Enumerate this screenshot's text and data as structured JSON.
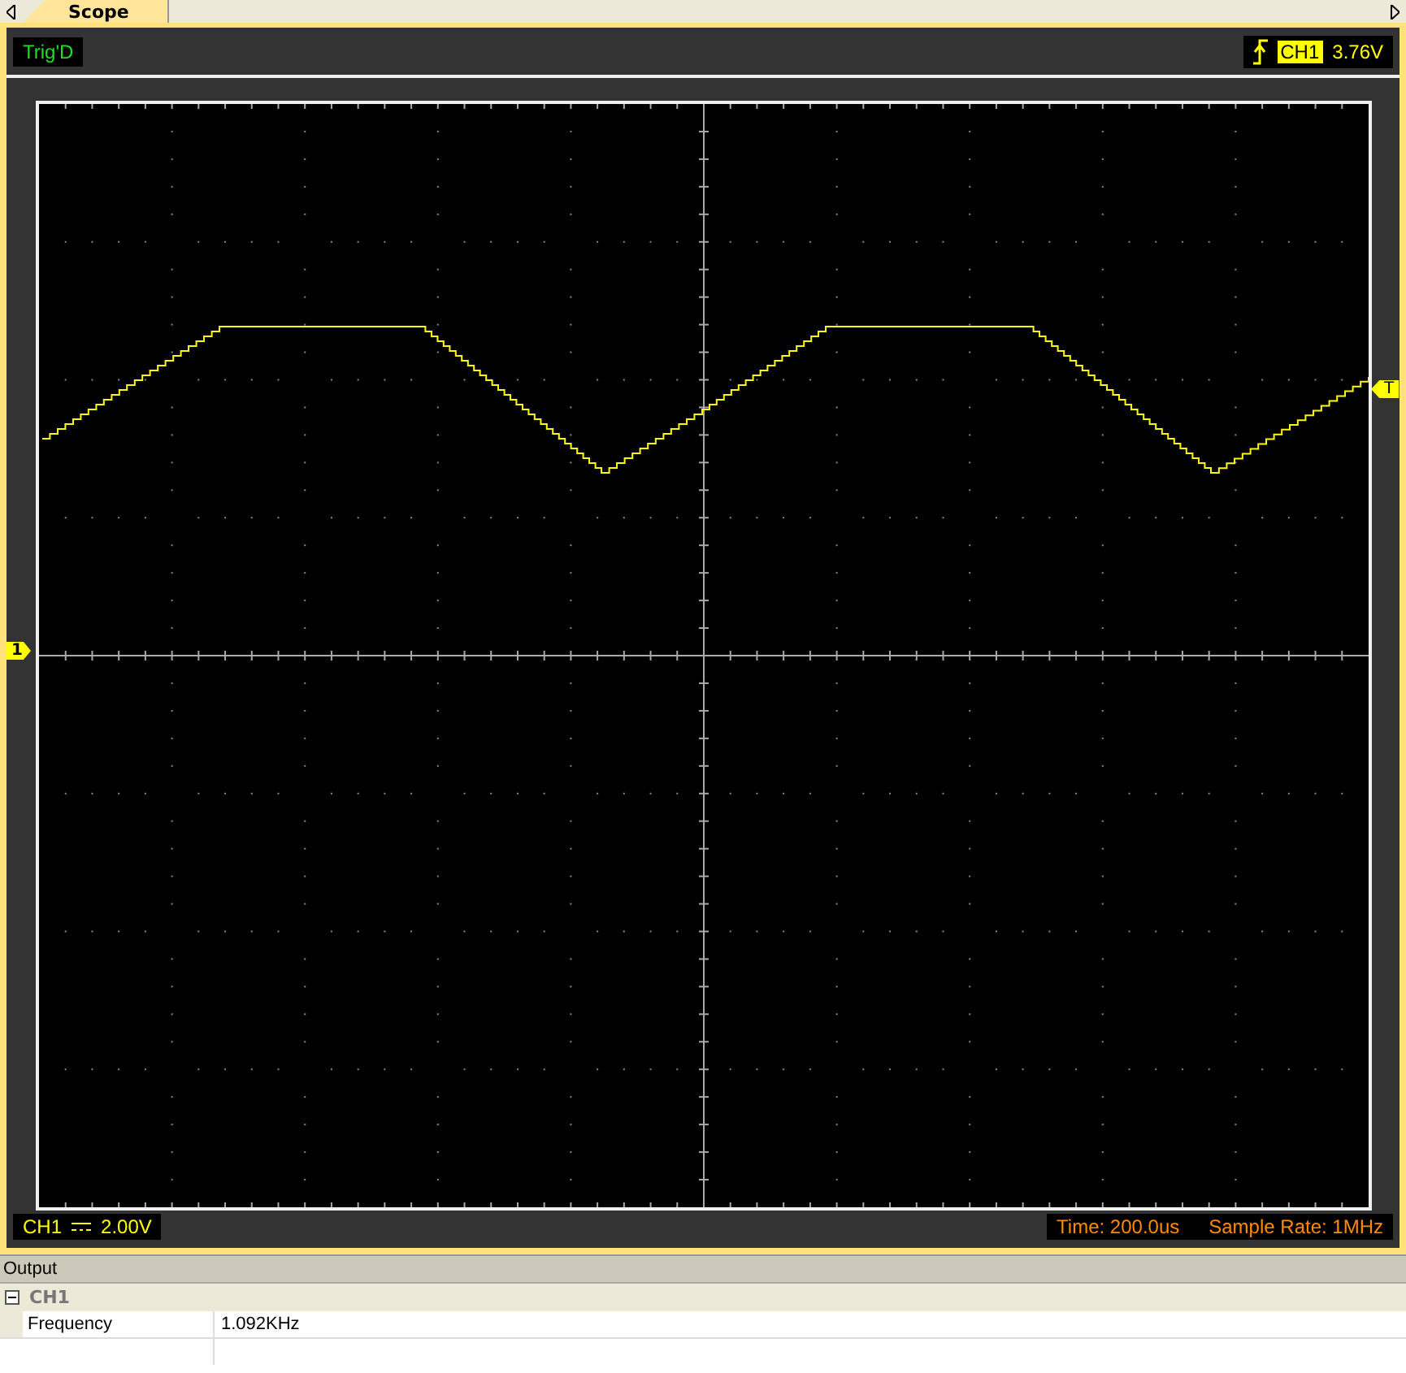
{
  "tabs": [
    {
      "label": "Scope",
      "selected": true
    }
  ],
  "trigger_status": "Trig'D",
  "trigger": {
    "channel": "CH1",
    "reading": "3.76V"
  },
  "channel_marker": "1",
  "trigger_marker": "T",
  "channel_scale": {
    "channel": "CH1",
    "reading": "2.00V"
  },
  "time": "Time: 200.0us",
  "sample_rate": "Sample Rate: 1MHz",
  "output": {
    "title": "Output",
    "groups": [
      {
        "name": "CH1",
        "expanded": true,
        "rows": [
          {
            "label": "Frequency",
            "value": "1.092KHz"
          }
        ]
      }
    ]
  }
}
